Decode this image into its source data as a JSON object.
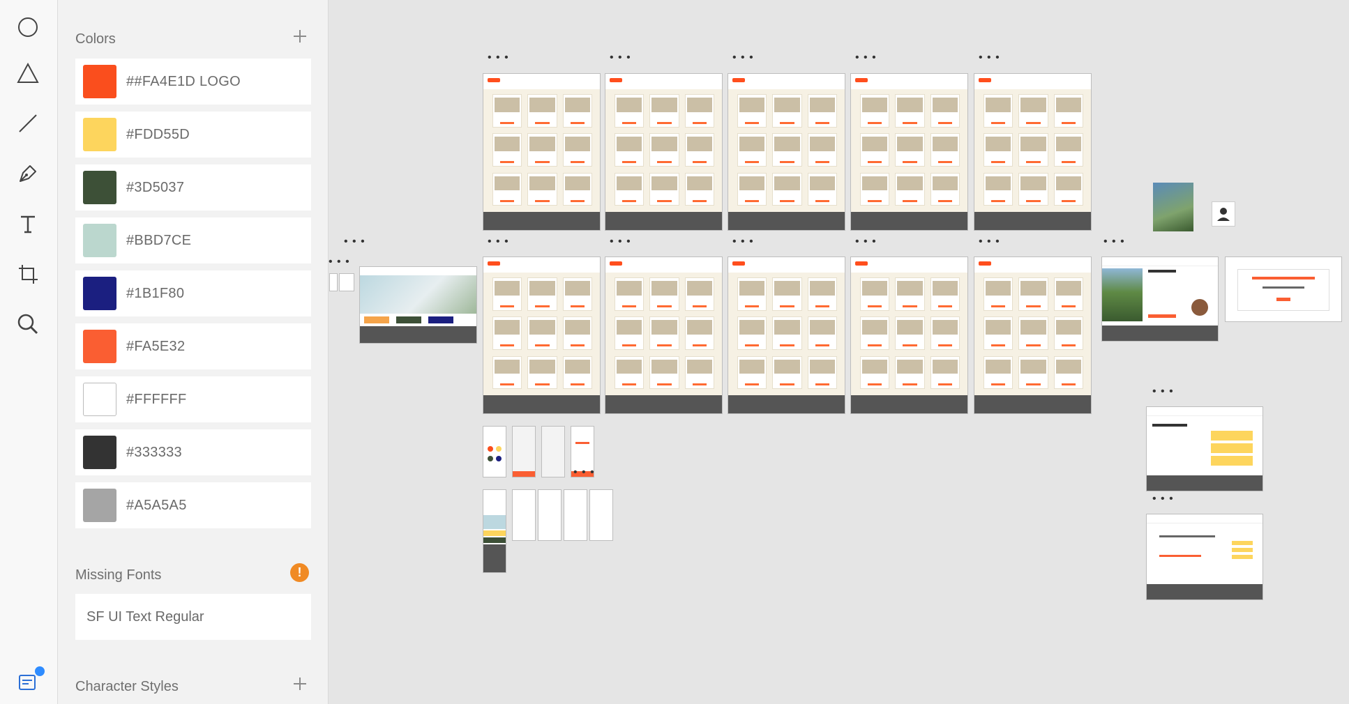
{
  "toolbar": {
    "tools": [
      {
        "name": "ellipse-tool",
        "icon": "circle-icon"
      },
      {
        "name": "polygon-tool",
        "icon": "triangle-icon"
      },
      {
        "name": "line-tool",
        "icon": "line-icon"
      },
      {
        "name": "pen-tool",
        "icon": "pen-icon"
      },
      {
        "name": "text-tool",
        "icon": "text-icon"
      },
      {
        "name": "artboard-tool",
        "icon": "artboard-icon"
      },
      {
        "name": "zoom-tool",
        "icon": "search-icon"
      }
    ],
    "bottom_icon": "assets-panel-icon",
    "notification_color": "#2f8cff"
  },
  "panel": {
    "colors_title": "Colors",
    "colors": [
      {
        "label": "##FA4E1D LOGO",
        "hex": "#FA4E1D"
      },
      {
        "label": "#FDD55D",
        "hex": "#FDD55D"
      },
      {
        "label": "#3D5037",
        "hex": "#3D5037"
      },
      {
        "label": "#BBD7CE",
        "hex": "#BBD7CE"
      },
      {
        "label": "#1B1F80",
        "hex": "#1B1F80"
      },
      {
        "label": "#FA5E32",
        "hex": "#FA5E32"
      },
      {
        "label": "#FFFFFF",
        "hex": "#FFFFFF"
      },
      {
        "label": "#333333",
        "hex": "#333333"
      },
      {
        "label": "#A5A5A5",
        "hex": "#A5A5A5"
      }
    ],
    "missing_fonts_title": "Missing Fonts",
    "missing_font": "SF UI Text Regular",
    "character_styles_title": "Character Styles"
  },
  "canvas": {
    "background": "#e5e5e5",
    "artboard_more_label": "• • •"
  }
}
